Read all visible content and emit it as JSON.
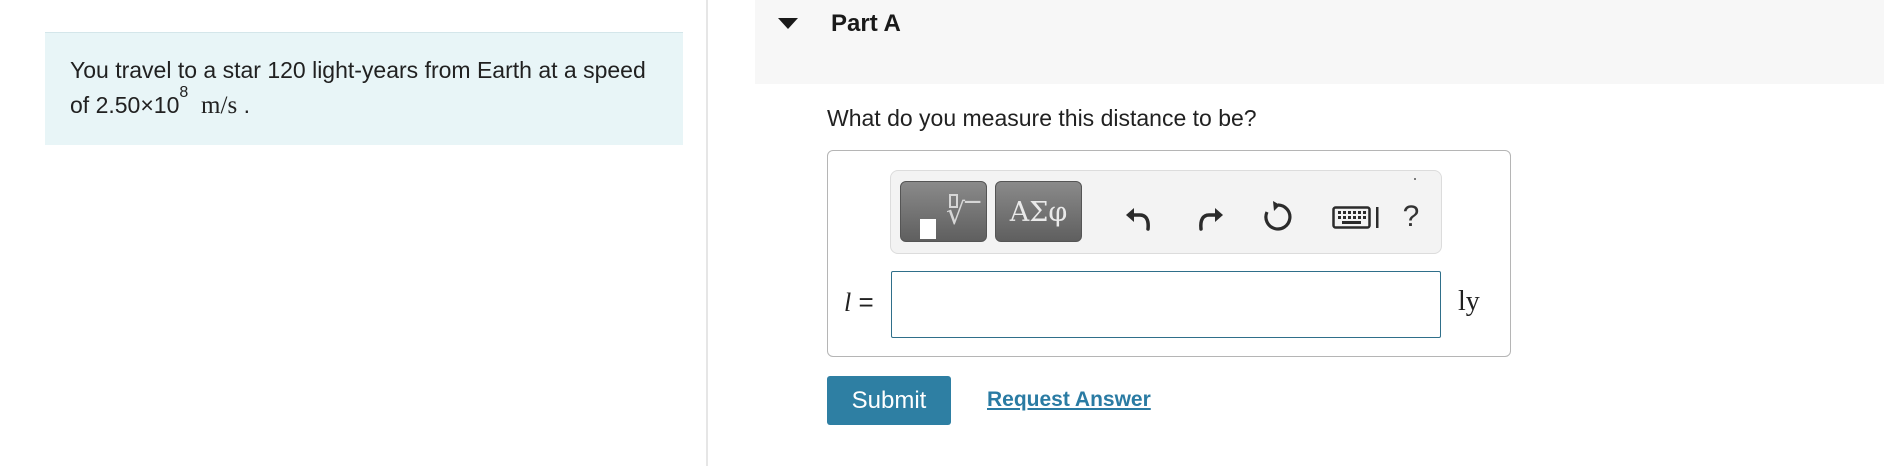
{
  "problem": {
    "text_before": "You travel to a star 120 light-years from Earth at a speed of ",
    "speed_mantissa": "2.50×10",
    "speed_exponent": "8",
    "speed_unit": "m/s",
    "text_after": "."
  },
  "part": {
    "title": "Part A",
    "question": "What do you measure this distance to be?"
  },
  "answer": {
    "variable": "l",
    "equals": "=",
    "value": "",
    "placeholder": "",
    "unit": "ly"
  },
  "toolbar": {
    "templates_icon": "template-sqrt-icon",
    "greek_label": "ΑΣφ",
    "undo_icon": "undo-icon",
    "redo_icon": "redo-icon",
    "reset_icon": "reset-icon",
    "keyboard_icon": "keyboard-icon",
    "help_label": "?"
  },
  "actions": {
    "submit_label": "Submit",
    "request_label": "Request Answer"
  },
  "colors": {
    "problem_bg": "#e8f5f7",
    "accent": "#2e7fa3",
    "link": "#2a7ba3"
  }
}
